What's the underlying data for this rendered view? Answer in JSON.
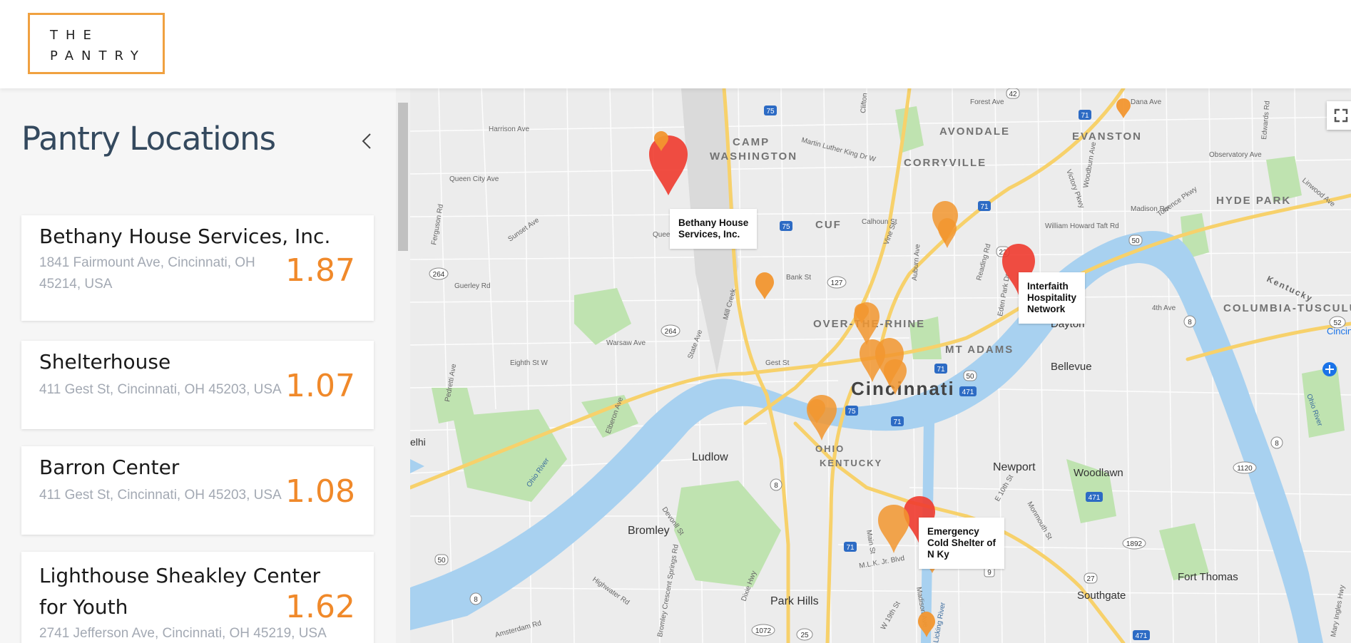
{
  "brand": {
    "line1": "THE",
    "line2": "PANTRY",
    "accent": "#f0a140"
  },
  "sidebar": {
    "title": "Pantry Locations",
    "collapse_icon": "chevron-left-icon",
    "locations": [
      {
        "name": "Bethany House Services, Inc.",
        "address_line1": "1841 Fairmount Ave, Cincinnati, OH",
        "address_line2": "45214, USA",
        "distance": "1.87"
      },
      {
        "name": "Shelterhouse",
        "address_line1": "411 Gest St, Cincinnati, OH 45203, USA",
        "distance": "1.07"
      },
      {
        "name": "Barron Center",
        "address_line1": "411 Gest St, Cincinnati, OH 45203, USA",
        "distance": "1.08"
      },
      {
        "name_line1": "Lighthouse Sheakley Center",
        "name_line2": "for Youth",
        "address_line1": "2741 Jefferson Ave, Cincinnati, OH 45219, USA",
        "distance": "1.62"
      }
    ]
  },
  "map": {
    "fullscreen_icon": "fullscreen-icon",
    "info_labels": [
      {
        "line1": "Bethany House",
        "line2": "Services, Inc."
      },
      {
        "line1": "Interfaith",
        "line2": "Hospitality",
        "line3": "Network"
      },
      {
        "line1": "Emergency",
        "line2": "Cold Shelter of",
        "line3": "N Ky"
      }
    ],
    "neighborhoods": [
      "CAMP",
      "WASHINGTON",
      "AVONDALE",
      "CORRYVILLE",
      "EVANSTON",
      "CUF",
      "HYDE PARK",
      "OVER-THE-RHINE",
      "MT ADAMS",
      "COLUMBIA-TUSCULU",
      "OHIO",
      "KENTUCKY"
    ],
    "cities": [
      "Cincinnati",
      "Newport",
      "Ludlow",
      "Bromley",
      "Park Hills",
      "Bellevue",
      "Dayton",
      "Woodlawn",
      "Fort Thomas",
      "Southgate",
      "elhi"
    ],
    "streets": [
      "Harrison Ave",
      "Queen City Ave",
      "Ferguson Rd",
      "Sunset Ave",
      "Guerley Rd",
      "Warsaw Ave",
      "Eighth St W",
      "Pedretti Ave",
      "Elberon Ave",
      "State Ave",
      "Mill Creek",
      "Gest St",
      "Bank St",
      "Martin Luther King Dr W",
      "Clifton",
      "Calhoun St",
      "Vine St",
      "Auburn Ave",
      "Reading Rd",
      "Forest Ave",
      "Dana Ave",
      "Victory Pkwy",
      "Woodburn Ave",
      "Madison Rd",
      "William Howard Taft Rd",
      "Observatory Ave",
      "Edwards Rd",
      "Linwood Ave",
      "Torrence Pkwy",
      "Eden Park Dr",
      "4th Ave",
      "Ohio River",
      "Main St",
      "M.L.K. Jr. Blvd",
      "Madison Ave",
      "W 19th St",
      "Licking River",
      "Monmouth St",
      "E 10th St",
      "Highwater Rd",
      "Devonll St",
      "Amsterdam Rd",
      "Bromley Crescent Springs Rd",
      "Dixie Hwy",
      "Queen",
      "Cincinnati Municipal Airport",
      "Mary Ingles Hwy",
      "Kentucky"
    ],
    "shields": [
      "75",
      "71",
      "471",
      "50",
      "42",
      "22",
      "27",
      "8",
      "264",
      "127",
      "52",
      "25",
      "1072",
      "1120",
      "1892",
      "9"
    ],
    "colors": {
      "water": "#a8d1f0",
      "land": "#ececec",
      "park": "#bfe3b0",
      "highway": "#f7d16b",
      "marker_orange": "#f2962f",
      "marker_red": "#ef3b2f"
    }
  }
}
